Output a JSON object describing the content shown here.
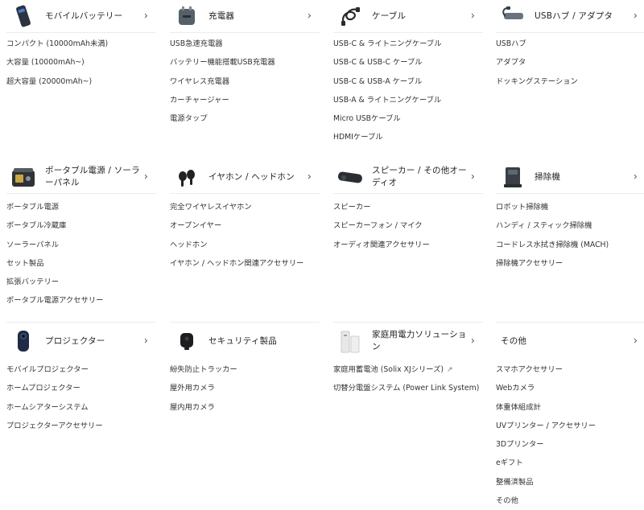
{
  "colors": {
    "text": "#333333",
    "heading": "#222222",
    "divider": "#ececec",
    "chevron": "#555555"
  },
  "categories": [
    {
      "title": "モバイルバッテリー",
      "icon": "power-bank-icon",
      "chevron": "›",
      "items": [
        "コンパクト (10000mAh未満)",
        "大容量 (10000mAh~)",
        "超大容量 (20000mAh~)"
      ]
    },
    {
      "title": "充電器",
      "icon": "charger-icon",
      "chevron": "›",
      "items": [
        "USB急速充電器",
        "バッテリー機能搭載USB充電器",
        "ワイヤレス充電器",
        "カーチャージャー",
        "電源タップ"
      ]
    },
    {
      "title": "ケーブル",
      "icon": "cable-icon",
      "chevron": "›",
      "items": [
        "USB-C & ライトニングケーブル",
        "USB-C & USB-C ケーブル",
        "USB-C & USB-A ケーブル",
        "USB-A & ライトニングケーブル",
        "Micro USBケーブル",
        "HDMIケーブル"
      ]
    },
    {
      "title": "USBハブ / アダプタ",
      "icon": "usb-hub-icon",
      "chevron": "›",
      "items": [
        "USBハブ",
        "アダプタ",
        "ドッキングステーション"
      ]
    },
    {
      "title": "ポータブル電源 / ソーラーパネル",
      "icon": "portable-power-icon",
      "chevron": "›",
      "items": [
        "ポータブル電源",
        "ポータブル冷蔵庫",
        "ソーラーパネル",
        "セット製品",
        "拡張バッテリー",
        "ポータブル電源アクセサリー"
      ]
    },
    {
      "title": "イヤホン / ヘッドホン",
      "icon": "earbuds-icon",
      "chevron": "›",
      "items": [
        "完全ワイヤレスイヤホン",
        "オープンイヤー",
        "ヘッドホン",
        "イヤホン / ヘッドホン関連アクセサリー"
      ]
    },
    {
      "title": "スピーカー / その他オーディオ",
      "icon": "speaker-icon",
      "chevron": "›",
      "items": [
        "スピーカー",
        "スピーカーフォン / マイク",
        "オーディオ関連アクセサリー"
      ]
    },
    {
      "title": "掃除機",
      "icon": "robot-vacuum-icon",
      "chevron": "›",
      "items": [
        "ロボット掃除機",
        "ハンディ / スティック掃除機",
        "コードレス水拭き掃除機 (MACH)",
        "掃除機アクセサリー"
      ]
    },
    {
      "title": "プロジェクター",
      "icon": "projector-icon",
      "chevron": "›",
      "items": [
        "モバイルプロジェクター",
        "ホームプロジェクター",
        "ホームシアターシステム",
        "プロジェクターアクセサリー"
      ]
    },
    {
      "title": "セキュリティ製品",
      "icon": "security-camera-icon",
      "chevron": "›",
      "items": [
        "紛失防止トラッカー",
        "屋外用カメラ",
        "屋内用カメラ"
      ]
    },
    {
      "title": "家庭用電力ソリューション",
      "icon": "home-battery-icon",
      "chevron": "›",
      "items": [
        "家庭用蓄電池 (Solix XJシリーズ)",
        "切替分電盤システム (Power Link System)"
      ],
      "external_icon": "external-link-icon",
      "external_glyph": "↗"
    },
    {
      "title": "その他",
      "icon": "",
      "chevron": "›",
      "items": [
        "スマホアクセサリー",
        "Webカメラ",
        "体重体組成計",
        "UVプリンター / アクセサリー",
        "3Dプリンター",
        "eギフト",
        "整備済製品",
        "その他"
      ]
    }
  ]
}
